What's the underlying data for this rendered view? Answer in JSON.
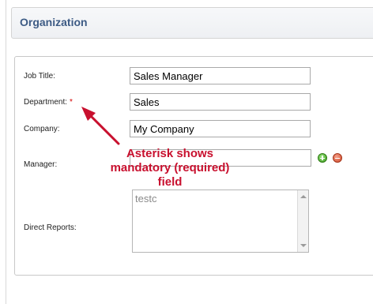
{
  "header": {
    "title": "Organization"
  },
  "form": {
    "job_title": {
      "label": "Job Title:",
      "value": "Sales Manager"
    },
    "department": {
      "label": "Department:",
      "required_mark": "*",
      "value": "Sales"
    },
    "company": {
      "label": "Company:",
      "value": "My Company"
    },
    "manager": {
      "label": "Manager:",
      "value": ""
    },
    "direct_reports": {
      "label": "Direct Reports:",
      "items": [
        "testc"
      ]
    }
  },
  "icons": {
    "add": "plus-circle-icon",
    "remove": "minus-circle-icon"
  },
  "colors": {
    "header_title": "#3d5b85",
    "required_mark": "#d40000",
    "annotation": "#c8102e",
    "add_button": "#3a9b1c",
    "remove_button": "#d24a2b"
  },
  "annotation": {
    "lines": [
      "Asterisk shows",
      "mandatory (required)",
      "field"
    ]
  }
}
